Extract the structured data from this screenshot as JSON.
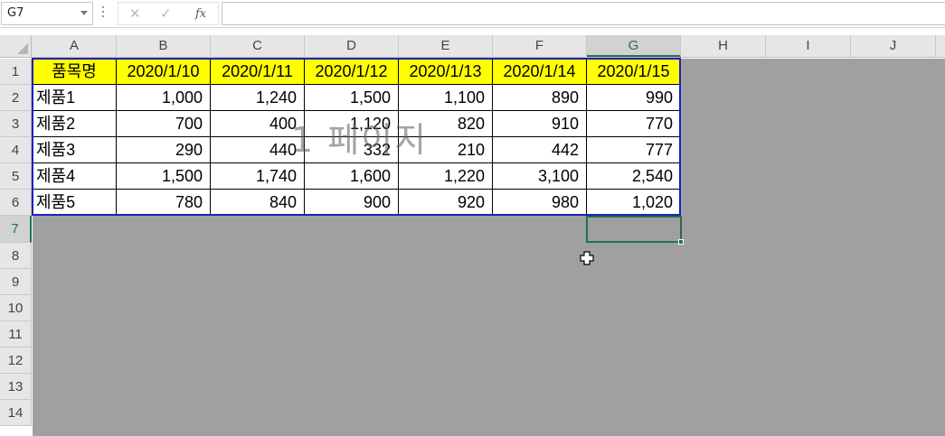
{
  "formula_bar": {
    "name_box": "G7",
    "cancel_icon": "✕",
    "enter_icon": "✓",
    "fx_label": "fx",
    "formula": ""
  },
  "columns": [
    "A",
    "B",
    "C",
    "D",
    "E",
    "F",
    "G",
    "H",
    "I",
    "J"
  ],
  "selected_column": "G",
  "rows": [
    "1",
    "2",
    "3",
    "4",
    "5",
    "6",
    "7",
    "8",
    "9",
    "10",
    "11",
    "12",
    "13",
    "14"
  ],
  "selected_row": "7",
  "table": {
    "headers": [
      "품목명",
      "2020/1/10",
      "2020/1/11",
      "2020/1/12",
      "2020/1/13",
      "2020/1/14",
      "2020/1/15"
    ],
    "rows": [
      [
        "제품1",
        "1,000",
        "1,240",
        "1,500",
        "1,100",
        "890",
        "990"
      ],
      [
        "제품2",
        "700",
        "400",
        "1,120",
        "820",
        "910",
        "770"
      ],
      [
        "제품3",
        "290",
        "440",
        "332",
        "210",
        "442",
        "777"
      ],
      [
        "제품4",
        "1,500",
        "1,740",
        "1,600",
        "1,220",
        "3,100",
        "2,540"
      ],
      [
        "제품5",
        "780",
        "840",
        "900",
        "920",
        "980",
        "1,020"
      ]
    ]
  },
  "watermark": "1 페이지",
  "colors": {
    "header_fill": "#ffff00",
    "print_area_border": "#1f1fbf",
    "selection": "#217346",
    "page_break_bg": "#a0a0a0"
  }
}
